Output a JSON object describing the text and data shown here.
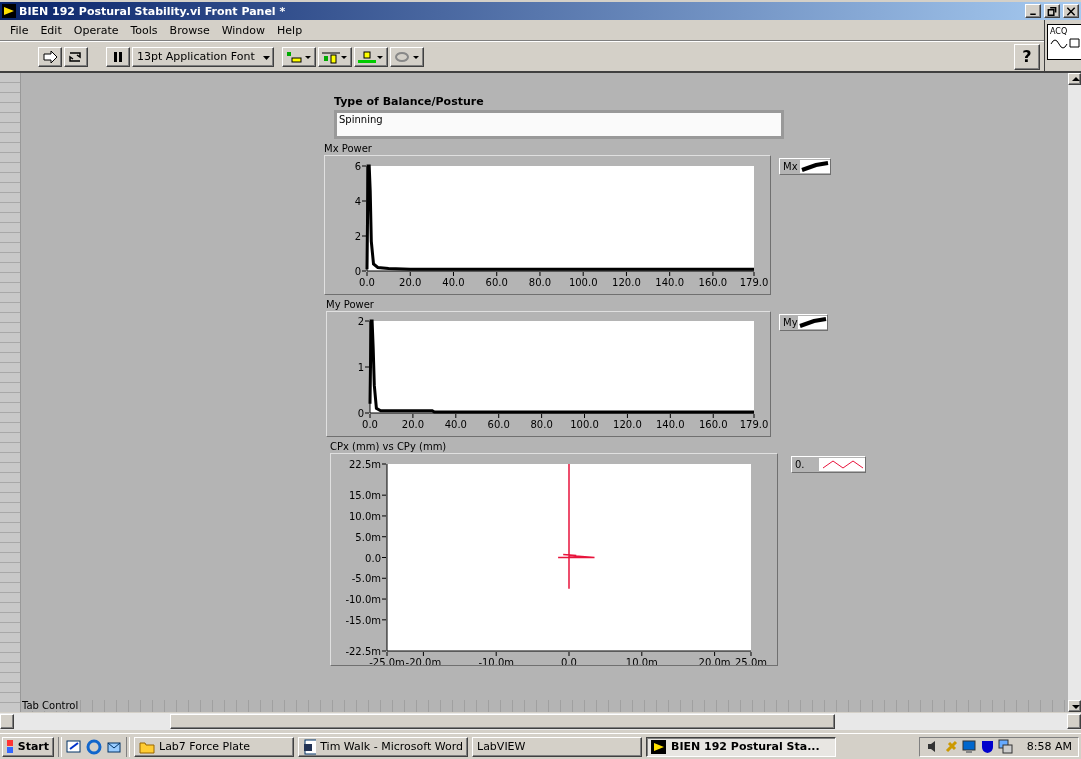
{
  "window": {
    "title": "BIEN 192 Postural Stability.vi Front Panel *"
  },
  "menu": [
    "File",
    "Edit",
    "Operate",
    "Tools",
    "Browse",
    "Window",
    "Help"
  ],
  "toolbar": {
    "font": "13pt Application Font",
    "help": "?",
    "vi_icon_text": "ACQ"
  },
  "panel": {
    "field": {
      "label": "Type of Balance/Posture",
      "value": "Spinning"
    },
    "graphs": [
      {
        "label": "Mx Power",
        "chart_data": {
          "type": "line",
          "xlim": [
            0,
            179
          ],
          "ylim": [
            0,
            6
          ],
          "x": [
            0,
            0.5,
            1,
            1.5,
            2,
            3,
            5,
            10,
            20,
            179
          ],
          "series": [
            {
              "name": "Mx",
              "color": "#000000",
              "values": [
                0.1,
                6,
                6,
                4.6,
                1.7,
                0.4,
                0.2,
                0.15,
                0.1,
                0.1
              ]
            }
          ],
          "xticks": [
            {
              "value": 0,
              "label": "0.0"
            },
            {
              "value": 20,
              "label": "20.0"
            },
            {
              "value": 40,
              "label": "40.0"
            },
            {
              "value": 60,
              "label": "60.0"
            },
            {
              "value": 80,
              "label": "80.0"
            },
            {
              "value": 100,
              "label": "100.0"
            },
            {
              "value": 120,
              "label": "120.0"
            },
            {
              "value": 140,
              "label": "140.0"
            },
            {
              "value": 160,
              "label": "160.0"
            },
            {
              "value": 179,
              "label": "179.0"
            }
          ],
          "yticks": [
            {
              "value": 0,
              "label": "0"
            },
            {
              "value": 2,
              "label": "2"
            },
            {
              "value": 4,
              "label": "4"
            },
            {
              "value": 6,
              "label": "6"
            }
          ]
        }
      },
      {
        "label": "My Power",
        "chart_data": {
          "type": "line",
          "xlim": [
            0,
            179
          ],
          "ylim": [
            0,
            2
          ],
          "x": [
            0,
            0.5,
            1,
            1.5,
            2,
            3,
            5,
            29,
            30,
            179
          ],
          "series": [
            {
              "name": "My",
              "color": "#000000",
              "values": [
                0.2,
                2,
                2,
                1.4,
                0.6,
                0.1,
                0.05,
                0.05,
                0.02,
                0.02
              ]
            }
          ],
          "xticks": [
            {
              "value": 0,
              "label": "0.0"
            },
            {
              "value": 20,
              "label": "20.0"
            },
            {
              "value": 40,
              "label": "40.0"
            },
            {
              "value": 60,
              "label": "60.0"
            },
            {
              "value": 80,
              "label": "80.0"
            },
            {
              "value": 100,
              "label": "100.0"
            },
            {
              "value": 120,
              "label": "120.0"
            },
            {
              "value": 140,
              "label": "140.0"
            },
            {
              "value": 160,
              "label": "160.0"
            },
            {
              "value": 179,
              "label": "179.0"
            }
          ],
          "yticks": [
            {
              "value": 0,
              "label": "0"
            },
            {
              "value": 1,
              "label": "1"
            },
            {
              "value": 2,
              "label": "2"
            }
          ]
        }
      },
      {
        "label": "CPx (mm) vs CPy (mm)",
        "chart_data": {
          "type": "line",
          "xlim": [
            -25,
            25
          ],
          "ylim": [
            -22.5,
            22.5
          ],
          "x": [
            0,
            0,
            0,
            -1.5,
            3.5,
            0,
            1,
            -0.8
          ],
          "series": [
            {
              "name": "0.",
              "color": "#e8143c",
              "values": [
                22.5,
                -7.5,
                0,
                0,
                0,
                0.5,
                0.5,
                0.7
              ]
            }
          ],
          "xticks": [
            {
              "value": -25,
              "label": "-25.0m"
            },
            {
              "value": -20,
              "label": "-20.0m"
            },
            {
              "value": -10,
              "label": "-10.0m"
            },
            {
              "value": 0,
              "label": "0.0"
            },
            {
              "value": 10,
              "label": "10.0m"
            },
            {
              "value": 20,
              "label": "20.0m"
            },
            {
              "value": 25,
              "label": "25.0m"
            }
          ],
          "yticks": [
            {
              "value": 22.5,
              "label": "22.5m"
            },
            {
              "value": 15,
              "label": "15.0m"
            },
            {
              "value": 10,
              "label": "10.0m"
            },
            {
              "value": 5,
              "label": "5.0m"
            },
            {
              "value": 0,
              "label": "0.0"
            },
            {
              "value": -5,
              "label": "-5.0m"
            },
            {
              "value": -10,
              "label": "-10.0m"
            },
            {
              "value": -15,
              "label": "-15.0m"
            },
            {
              "value": -22.5,
              "label": "-22.5m"
            }
          ]
        }
      }
    ],
    "tab_control": "Tab Control"
  },
  "taskbar": {
    "start": "Start",
    "tasks": [
      {
        "label": "Lab7 Force Plate",
        "kind": "folder",
        "selected": false
      },
      {
        "label": "Tim Walk - Microsoft Word",
        "kind": "document",
        "selected": false
      },
      {
        "label": "LabVIEW",
        "kind": "plain",
        "selected": false
      },
      {
        "label": "BIEN 192 Postural Sta...",
        "kind": "vi",
        "selected": true
      }
    ],
    "clock": "8:58 AM"
  }
}
